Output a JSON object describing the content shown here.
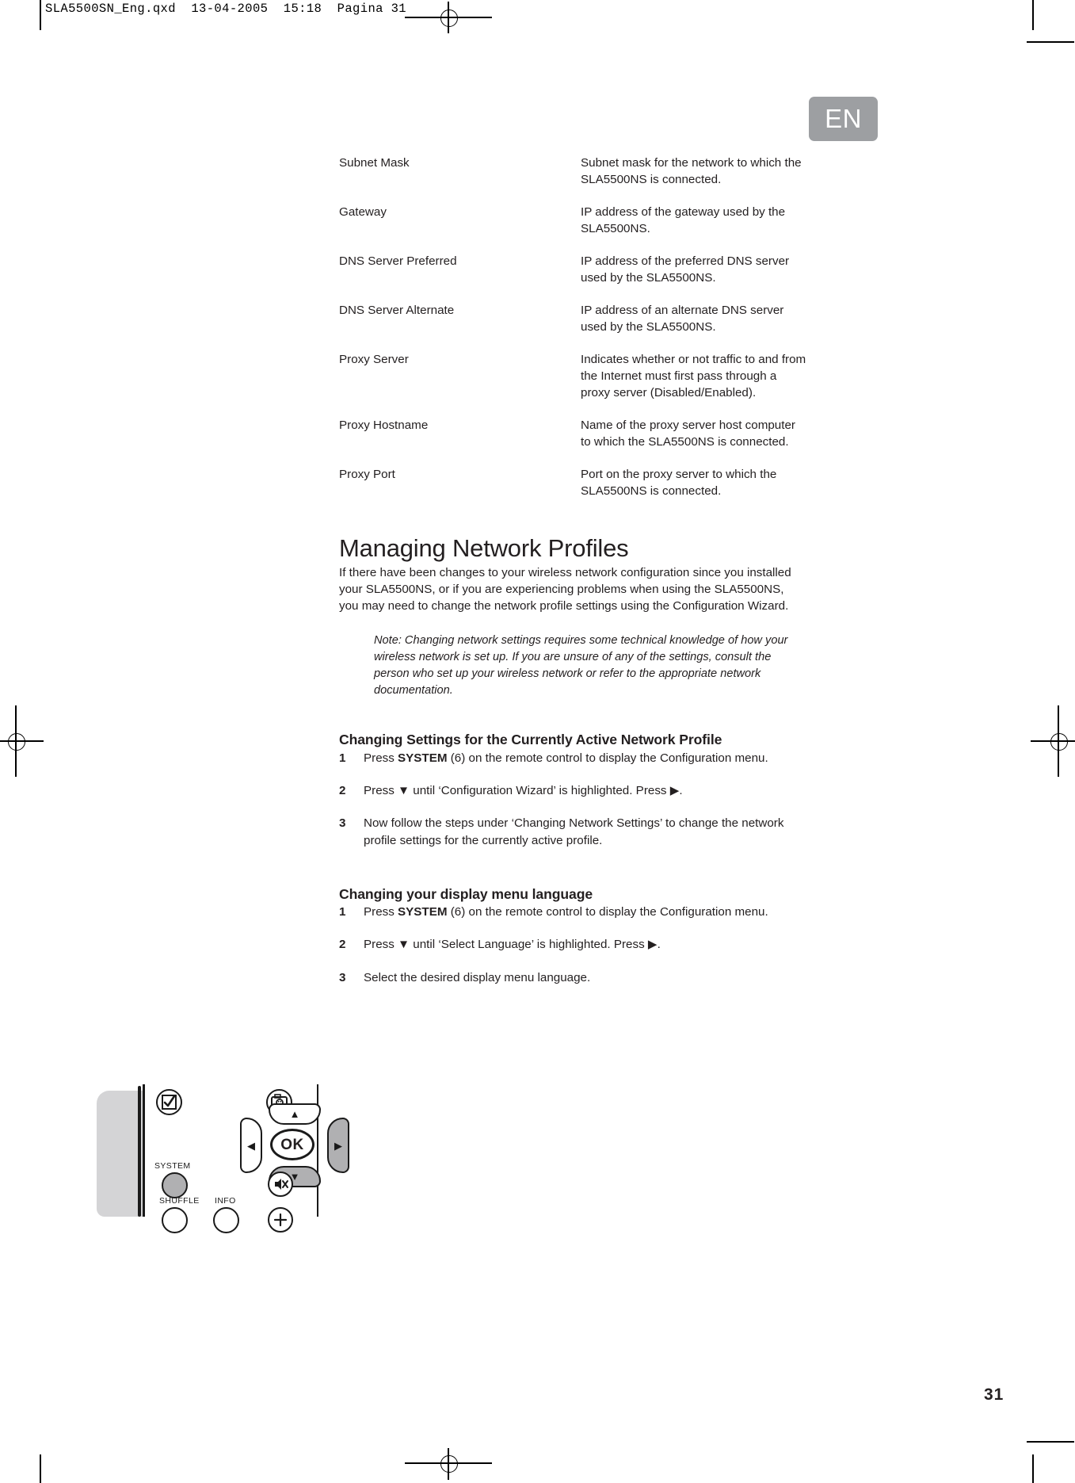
{
  "header": {
    "filename_line": "SLA5500SN_Eng.qxd  13-04-2005  15:18  Pagina 31"
  },
  "lang_tab": {
    "label": "EN"
  },
  "page_number": "31",
  "definitions": [
    {
      "term": "Subnet Mask",
      "description": "Subnet mask for the network to which the SLA5500NS is connected."
    },
    {
      "term": "Gateway",
      "description": "IP address of the gateway used by the SLA5500NS."
    },
    {
      "term": "DNS Server Preferred",
      "description": "IP address of the preferred DNS server used by the SLA5500NS."
    },
    {
      "term": "DNS Server Alternate",
      "description": "IP address of an alternate DNS server used by the SLA5500NS."
    },
    {
      "term": "Proxy Server",
      "description": "Indicates whether or not traffic to and from the Internet must first pass through a proxy server (Disabled/Enabled)."
    },
    {
      "term": "Proxy Hostname",
      "description": "Name of the proxy server host computer to which the SLA5500NS is connected."
    },
    {
      "term": "Proxy Port",
      "description": "Port on the proxy server to which the SLA5500NS is connected."
    }
  ],
  "section": {
    "title": "Managing Network Profiles",
    "intro": "If there have been changes to your wireless network configuration since you installed your SLA5500NS, or if you are experiencing problems when using the SLA5500NS, you may need to change the network profile settings using the Configuration Wizard.",
    "note": "Note: Changing network settings requires some technical knowledge of how your wireless network is set up. If you are unsure of any of the settings, consult the person who set up your wireless network or refer to the appropriate network documentation."
  },
  "subsection_active_profile": {
    "title": "Changing Settings for the Currently Active Network Profile",
    "steps": [
      {
        "num": "1",
        "pre": "Press ",
        "bold": "SYSTEM",
        "post": " (6) on the remote control to display the Configuration menu."
      },
      {
        "num": "2",
        "pre": "Press ▼ until ‘Configuration Wizard’ is highlighted. Press ▶.",
        "bold": "",
        "post": ""
      },
      {
        "num": "3",
        "pre": "Now follow the steps under ‘Changing Network Settings’ to change the network profile settings for the currently active profile.",
        "bold": "",
        "post": ""
      }
    ]
  },
  "subsection_language": {
    "title": "Changing your display menu language",
    "steps": [
      {
        "num": "1",
        "pre": "Press ",
        "bold": "SYSTEM",
        "post": " (6) on the remote control to display the Configuration menu."
      },
      {
        "num": "2",
        "pre": "Press ▼ until ‘Select Language’ is highlighted. Press ▶.",
        "bold": "",
        "post": ""
      },
      {
        "num": "3",
        "pre": "Select the desired display menu language.",
        "bold": "",
        "post": ""
      }
    ]
  },
  "remote": {
    "ok_label": "OK",
    "system_label": "SYSTEM",
    "shuffle_label": "SHUFFLE",
    "info_label": "INFO",
    "buttons": {
      "up": "▲",
      "down": "▼",
      "left": "◀",
      "right": "▶"
    }
  },
  "colors": {
    "tab_gray": "#9d9fa2",
    "text": "#231f20",
    "button_gray": "#b0b0b2",
    "illustration_shadow": "#d4d4d6"
  }
}
